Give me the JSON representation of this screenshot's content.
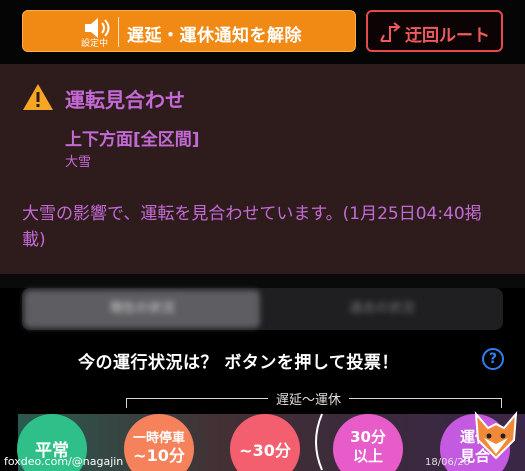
{
  "top_bar": {
    "notify_button": {
      "speaker_label": "設定中",
      "label": "遅延・運休通知を解除"
    },
    "detour_button": {
      "label": "迂回ルート"
    }
  },
  "alert": {
    "title": "運転見合わせ",
    "section_title": "上下方面[全区間]",
    "section_subtitle": "大雪",
    "body": "大雪の影響で、運転を見合わせています。(1月25日04:40掲載)"
  },
  "tabs": [
    {
      "label": "現在の状況"
    },
    {
      "label": "過去の状況"
    }
  ],
  "vote": {
    "prompt": "今の運行状況は？ ボタンを押して投票！",
    "help_icon": "question-circle-icon",
    "range_label": "遅延〜運休",
    "options": [
      {
        "label": "平常"
      },
      {
        "line1": "一時停車",
        "line2": "~10分"
      },
      {
        "label": "~30分"
      },
      {
        "line1": "30分",
        "line2": "以上"
      },
      {
        "line1": "運休",
        "line2": "見合"
      }
    ]
  },
  "watermark": "foxdeo.com/@nagajin",
  "date_stamp": "18/06/26",
  "colors": {
    "accent_orange": "#f08a14",
    "detour_red": "#e5484d",
    "alert_purple": "#c46ad6",
    "help_blue": "#2f7ff0"
  }
}
